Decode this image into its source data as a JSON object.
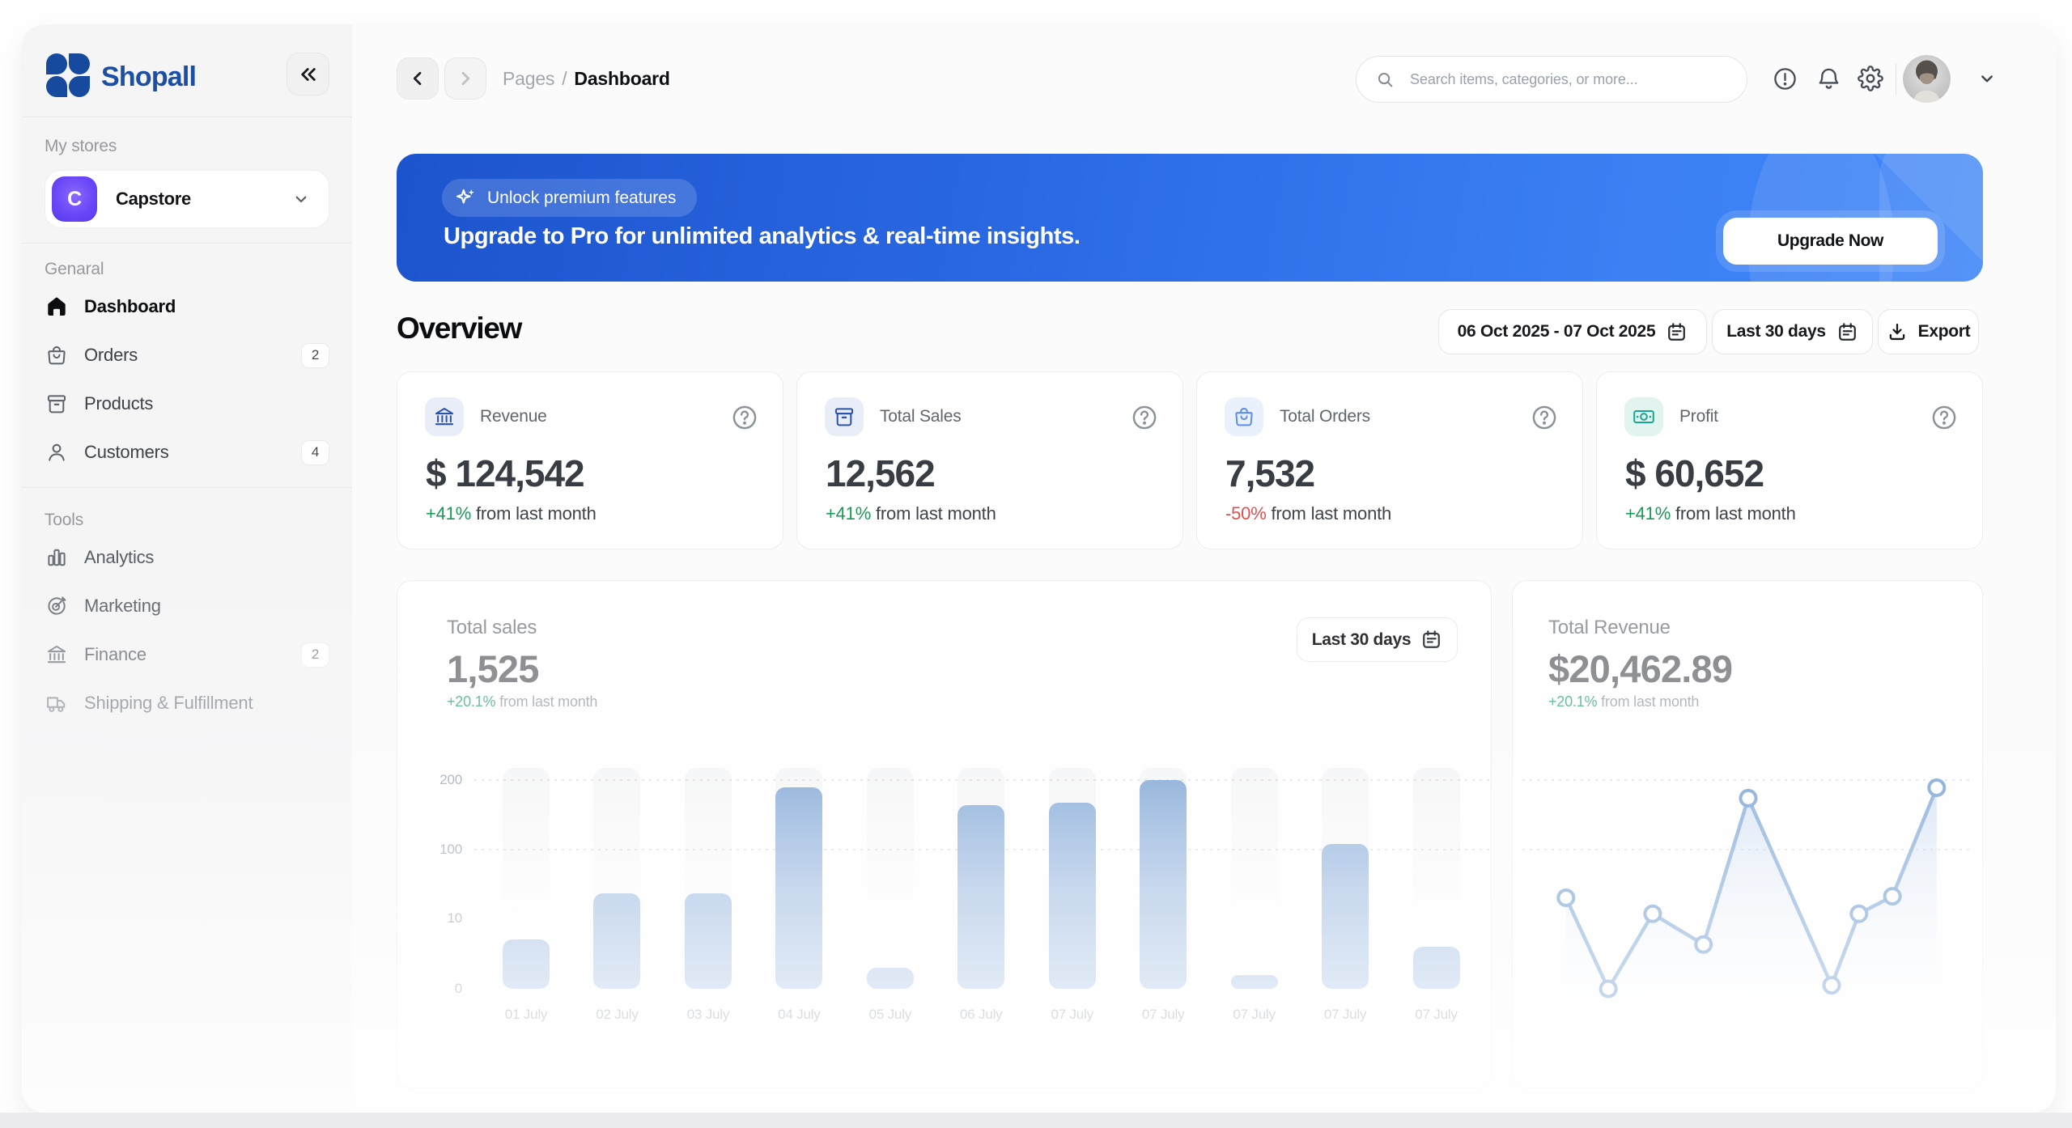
{
  "app": {
    "name": "Shopall",
    "brand_color": "#1a4fa5"
  },
  "sidebar": {
    "stores_label": "My stores",
    "store": {
      "name": "Capstore",
      "initial": "C",
      "accent": "#6a48f7"
    },
    "sections": [
      {
        "label": "Genaral",
        "items": [
          {
            "label": "Dashboard",
            "icon": "home-icon",
            "active": true
          },
          {
            "label": "Orders",
            "icon": "shopping-bag-icon",
            "badge": "2"
          },
          {
            "label": "Products",
            "icon": "box-icon"
          },
          {
            "label": "Customers",
            "icon": "user-icon",
            "badge": "4"
          }
        ]
      },
      {
        "label": "Tools",
        "items": [
          {
            "label": "Analytics",
            "icon": "bar-chart-icon"
          },
          {
            "label": "Marketing",
            "icon": "target-icon"
          },
          {
            "label": "Finance",
            "icon": "bank-icon",
            "badge": "2"
          },
          {
            "label": "Shipping & Fulfillment",
            "icon": "truck-icon"
          }
        ]
      }
    ]
  },
  "topbar": {
    "breadcrumb": {
      "section": "Pages",
      "separator": "/",
      "current": "Dashboard"
    },
    "search": {
      "placeholder": "Search items, categories, or more...",
      "value": ""
    }
  },
  "banner": {
    "pill": "Unlock premium features",
    "heading": "Upgrade to Pro for unlimited analytics & real-time insights.",
    "cta": "Upgrade Now",
    "gradient": [
      "#1c54cd",
      "#3f86f7"
    ]
  },
  "overview": {
    "title": "Overview",
    "date_range": "06 Oct 2025 - 07 Oct 2025",
    "period": "Last 30 days",
    "export_label": "Export"
  },
  "stats": [
    {
      "label": "Revenue",
      "value": "$ 124,542",
      "delta": "+41%",
      "delta_dir": "up",
      "delta_suffix": "from last month",
      "icon": "bank-icon",
      "accent": "blue"
    },
    {
      "label": "Total Sales",
      "value": "12,562",
      "delta": "+41%",
      "delta_dir": "up",
      "delta_suffix": "from last month",
      "icon": "archive-box-icon",
      "accent": "blue"
    },
    {
      "label": "Total Orders",
      "value": "7,532",
      "delta": "-50%",
      "delta_dir": "down",
      "delta_suffix": "from last month",
      "icon": "shopping-bag-icon",
      "accent": "lightblue"
    },
    {
      "label": "Profit",
      "value": "$ 60,652",
      "delta": "+41%",
      "delta_dir": "up",
      "delta_suffix": "from last month",
      "icon": "banknote-icon",
      "accent": "teal"
    }
  ],
  "status_colors": {
    "positive": "#169a55",
    "negative": "#e04f4f"
  },
  "chart_data": [
    {
      "type": "bar",
      "title": "Total sales",
      "total": "1,525",
      "delta": "+20.1%",
      "delta_suffix": "from last month",
      "period": "Last 30 days",
      "ylabel": "",
      "xlabel": "",
      "y_ticks": [
        0,
        10,
        100,
        200
      ],
      "grid": "dotted horizontal at 100 and 200",
      "categories": [
        "01 July",
        "02 July",
        "03 July",
        "04 July",
        "05 July",
        "06 July",
        "07 July",
        "07 July",
        "07 July",
        "07 July",
        "07 July"
      ],
      "values": [
        7,
        43,
        43,
        190,
        3,
        164,
        167,
        200,
        2,
        108,
        6
      ]
    },
    {
      "type": "line",
      "title": "Total Revenue",
      "total": "$20,462.89",
      "delta": "+20.1%",
      "delta_suffix": "from last month",
      "ylabel": "",
      "xlabel": "",
      "grid": "dotted horizontal at 100 and 200",
      "points": [
        {
          "x": 11.3,
          "v": 37
        },
        {
          "x": 20.3,
          "v": 0
        },
        {
          "x": 29.7,
          "v": 16
        },
        {
          "x": 40.5,
          "v": 6.3
        },
        {
          "x": 50.0,
          "v": 174
        },
        {
          "x": 67.7,
          "v": 0.5
        },
        {
          "x": 73.5,
          "v": 16
        },
        {
          "x": 80.6,
          "v": 39
        },
        {
          "x": 90.0,
          "v": 189
        }
      ]
    }
  ]
}
